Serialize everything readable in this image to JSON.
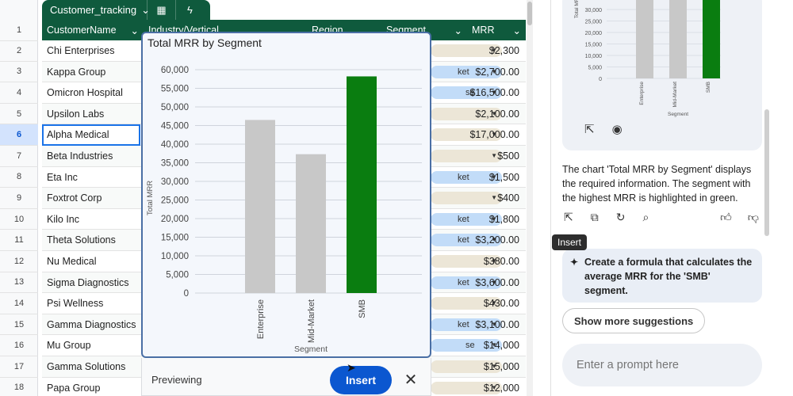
{
  "sheet": {
    "table_name": "Customer_tracking",
    "headers": {
      "name": "CustomerName",
      "industry": "Industry/Vertical",
      "region": "Region",
      "segment": "Segment",
      "mrr": "MRR"
    },
    "header_row_num": "1",
    "rows": [
      {
        "num": "2",
        "name": "Chi Enterprises",
        "chip": "",
        "mrr": "$2,300"
      },
      {
        "num": "3",
        "name": "Kappa Group",
        "chip": "ket",
        "mrr": "$2,700.00"
      },
      {
        "num": "4",
        "name": "Omicron Hospital",
        "chip": "se",
        "mrr": "$16,500.00"
      },
      {
        "num": "5",
        "name": "Upsilon Labs",
        "chip": "",
        "mrr": "$2,100.00"
      },
      {
        "num": "6",
        "name": "Alpha Medical Center",
        "chip": "",
        "mrr": "$17,000.00"
      },
      {
        "num": "7",
        "name": "Beta Industries",
        "chip": "",
        "mrr": "$500"
      },
      {
        "num": "8",
        "name": "Eta Inc",
        "chip": "ket",
        "mrr": "$1,500"
      },
      {
        "num": "9",
        "name": "Foxtrot Corp",
        "chip": "",
        "mrr": "$400"
      },
      {
        "num": "10",
        "name": "Kilo Inc",
        "chip": "ket",
        "mrr": "$1,800"
      },
      {
        "num": "11",
        "name": "Theta Solutions",
        "chip": "ket",
        "mrr": "$3,200.00"
      },
      {
        "num": "12",
        "name": "Nu Medical",
        "chip": "",
        "mrr": "$380.00"
      },
      {
        "num": "13",
        "name": "Sigma Diagnostics",
        "chip": "ket",
        "mrr": "$3,600.00"
      },
      {
        "num": "14",
        "name": "Psi Wellness",
        "chip": "",
        "mrr": "$430.00"
      },
      {
        "num": "15",
        "name": "Gamma Diagnostics",
        "chip": "ket",
        "mrr": "$3,100.00"
      },
      {
        "num": "16",
        "name": "Mu Group",
        "chip": "se",
        "mrr": "$14,000"
      },
      {
        "num": "17",
        "name": "Gamma Solutions",
        "chip": "",
        "mrr": "$15,000"
      },
      {
        "num": "18",
        "name": "Papa Group",
        "chip": "",
        "mrr": "$12,000"
      }
    ]
  },
  "chart_popup": {
    "preview_label": "Previewing",
    "insert_label": "Insert",
    "close_symbol": "✕"
  },
  "chart_data": {
    "type": "bar",
    "title": "Total MRR by Segment",
    "xlabel": "Segment",
    "ylabel": "Total MRR",
    "categories": [
      "Enterprise",
      "Mid-Market",
      "SMB"
    ],
    "values": [
      46500,
      37300,
      58200
    ],
    "colors": [
      "#c8c8c8",
      "#c8c8c8",
      "#0a7d10"
    ],
    "ylim": [
      0,
      60000
    ],
    "yticks": [
      0,
      5000,
      10000,
      15000,
      20000,
      25000,
      30000,
      35000,
      40000,
      45000,
      50000,
      55000,
      60000
    ],
    "ytick_labels": [
      "0",
      "5,000",
      "10,000",
      "15,000",
      "20,000",
      "25,000",
      "30,000",
      "35,000",
      "40,000",
      "45,000",
      "50,000",
      "55,000",
      "60,000"
    ],
    "grid": true
  },
  "mini_chart": {
    "ylabel": "Total MRR",
    "xlabel": "Segment",
    "categories": [
      "Enterprise",
      "Mid-Market",
      "SMB"
    ],
    "ytick_labels": [
      "0",
      "5,000",
      "10,000",
      "15,000",
      "20,000",
      "25,000",
      "30,000"
    ]
  },
  "panel": {
    "response_text": "The chart 'Total MRR by Segment' displays the required information. The segment with the highest MRR is highlighted in green.",
    "tooltip": "Insert",
    "suggestion": "Create a formula that calculates the average MRR for the 'SMB' segment.",
    "more_suggestions": "Show more suggestions",
    "prompt_placeholder": "Enter a prompt here"
  },
  "colors": {
    "header_green": "#0f5a3d",
    "accent_blue": "#0b57d0",
    "highlight_green": "#0a7d10"
  }
}
